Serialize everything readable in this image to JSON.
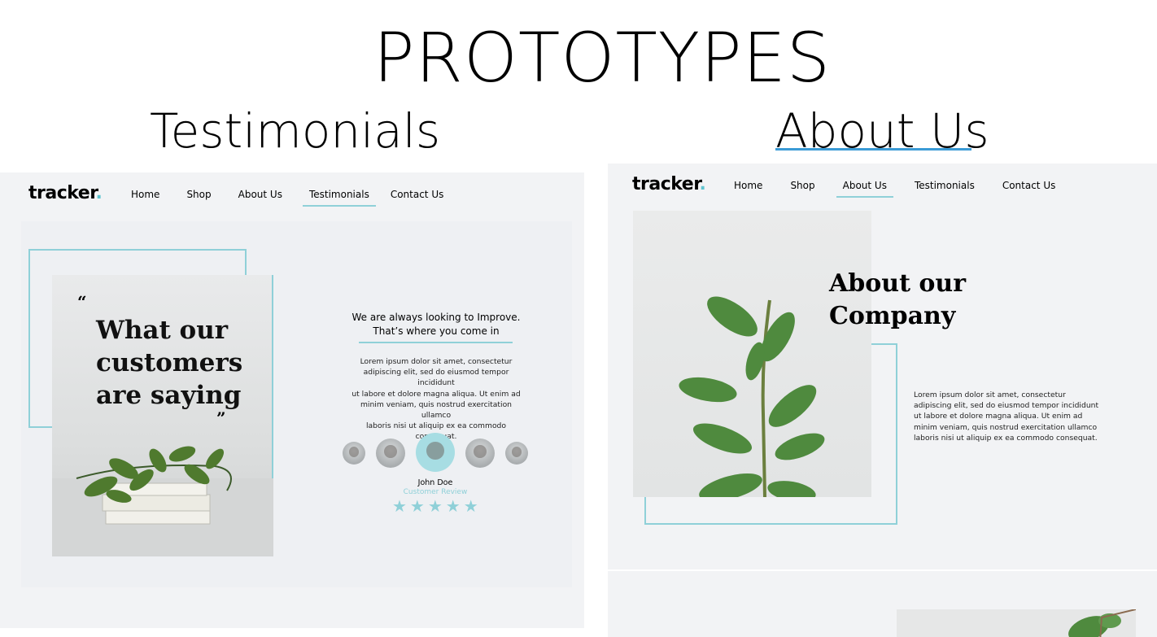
{
  "page": {
    "title": "PROTOTYPES"
  },
  "sections": {
    "testimonials_title": "Testimonials",
    "about_title": "About Us"
  },
  "left": {
    "logo": "tracker",
    "logo_dot": ".",
    "nav": [
      "Home",
      "Shop",
      "About Us",
      "Testimonials",
      "Contact Us"
    ],
    "active_nav": "Testimonials",
    "quote_open": "“",
    "quote_close": "”",
    "headline": [
      "What our",
      "customers",
      "are saying"
    ],
    "improve": [
      "We are always looking to Improve.",
      "That’s where you come in"
    ],
    "lorem": [
      "Lorem ipsum dolor sit amet, consectetur",
      "adipiscing elit, sed do eiusmod tempor incididunt",
      "ut labore et dolore magna aliqua. Ut enim ad",
      "minim veniam, quis nostrud exercitation ullamco",
      "laboris nisi ut aliquip ex ea commodo consequat."
    ],
    "reviewer_name": "John Doe",
    "reviewer_role": "Customer Review",
    "stars": "★★★★★",
    "rating": 5
  },
  "right": {
    "logo": "tracker",
    "logo_dot": ".",
    "nav": [
      "Home",
      "Shop",
      "About Us",
      "Testimonials",
      "Contact Us"
    ],
    "active_nav": "About Us",
    "headline": [
      "About our",
      "Company"
    ],
    "lorem": [
      "Lorem ipsum dolor sit amet, consectetur",
      "adipiscing elit, sed do eiusmod tempor incididunt",
      "ut labore et dolore magna aliqua. Ut enim ad",
      "minim veniam, quis nostrud exercitation ullamco",
      "laboris nisi ut aliquip ex ea commodo consequat."
    ]
  },
  "colors": {
    "accent": "#8fd0d8",
    "title_underline": "#3b9bd6",
    "card_bg": "#f2f3f5"
  }
}
